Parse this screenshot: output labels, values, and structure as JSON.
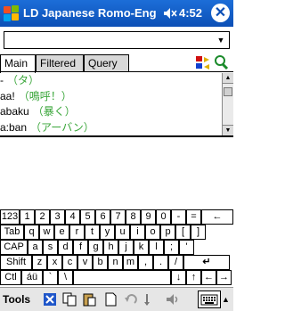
{
  "titlebar": {
    "app_title": "LD Japanese Romo-Eng",
    "time": "4:52",
    "close_label": "✕",
    "colors": {
      "background": "#1c6ed8"
    }
  },
  "search": {
    "value": "",
    "placeholder": ""
  },
  "tabs": [
    {
      "label": "Main",
      "active": true
    },
    {
      "label": "Filtered",
      "active": false
    },
    {
      "label": "Query",
      "active": false
    }
  ],
  "results": [
    {
      "romaji": "-",
      "kana": "（タ）"
    },
    {
      "romaji": "aa!",
      "kana": "（鳴呼！）"
    },
    {
      "romaji": "abaku",
      "kana": "（暴く）"
    },
    {
      "romaji": "a:ban",
      "kana": "（アーバン）"
    }
  ],
  "keyboard": {
    "rows": [
      [
        "123",
        "1",
        "2",
        "3",
        "4",
        "5",
        "6",
        "7",
        "8",
        "9",
        "0",
        "-",
        "=",
        "←"
      ],
      [
        "Tab",
        "q",
        "w",
        "e",
        "r",
        "t",
        "y",
        "u",
        "i",
        "o",
        "p",
        "[",
        "]"
      ],
      [
        "CAP",
        "a",
        "s",
        "d",
        "f",
        "g",
        "h",
        "j",
        "k",
        "l",
        ";",
        "'"
      ],
      [
        "Shift",
        "z",
        "x",
        "c",
        "v",
        "b",
        "n",
        "m",
        ",",
        ".",
        "/",
        "↵"
      ],
      [
        "Ctl",
        "áü",
        "`",
        "\\",
        "",
        "↓",
        "↑",
        "←",
        "→"
      ]
    ]
  },
  "menubar": {
    "tools_label": "Tools"
  }
}
